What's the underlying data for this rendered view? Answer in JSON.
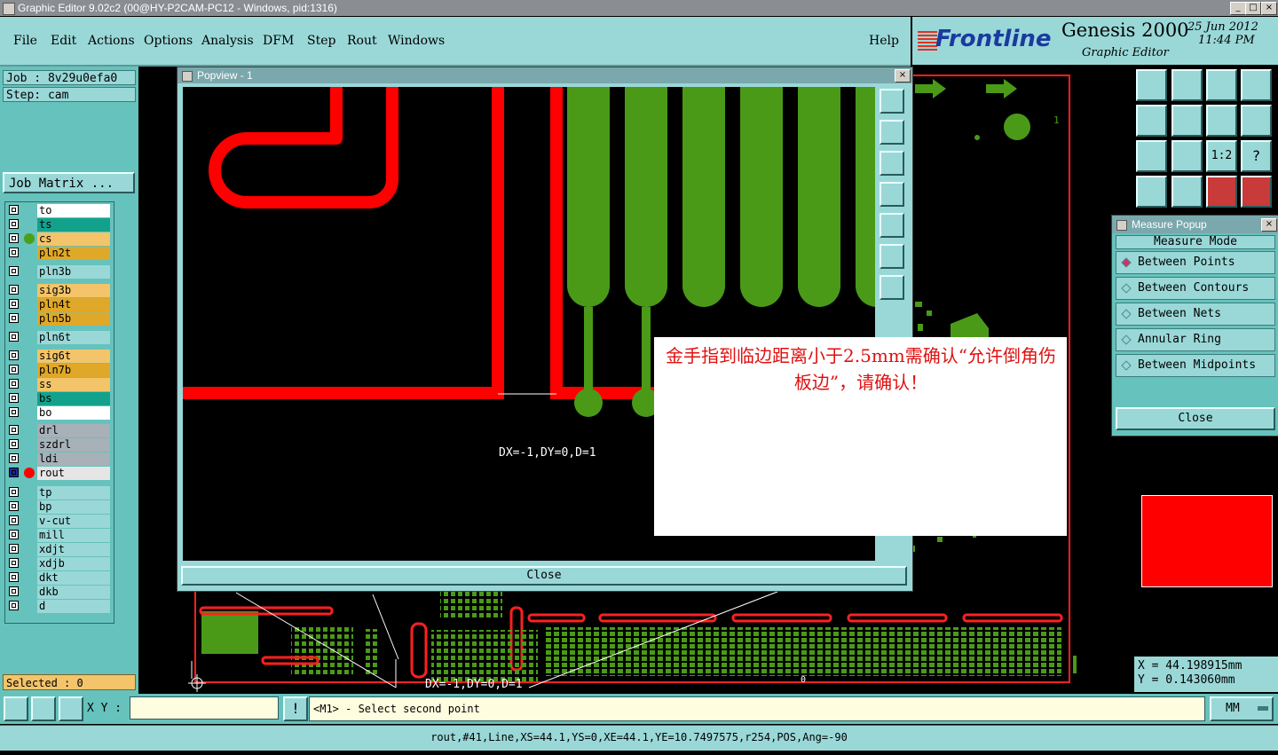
{
  "window": {
    "title": "Graphic Editor 9.02c2 (00@HY-P2CAM-PC12 - Windows, pid:1316)"
  },
  "menu": [
    {
      "id": "file",
      "label": "File"
    },
    {
      "id": "edit",
      "label": "Edit"
    },
    {
      "id": "actions",
      "label": "Actions"
    },
    {
      "id": "options",
      "label": "Options"
    },
    {
      "id": "analysis",
      "label": "Analysis"
    },
    {
      "id": "dfm",
      "label": "DFM"
    },
    {
      "id": "step",
      "label": "Step"
    },
    {
      "id": "rout",
      "label": "Rout"
    },
    {
      "id": "windows",
      "label": "Windows"
    }
  ],
  "help_label": "Help",
  "brand": {
    "logo": "Frontline",
    "product": "Genesis 2000",
    "subtitle": "Graphic Editor",
    "date": "25 Jun 2012",
    "time": "11:44 PM"
  },
  "job": {
    "job_label": "Job : 8v29u0efa0",
    "step_label": "Step: cam",
    "matrix_button": "Job Matrix ..."
  },
  "layers": [
    {
      "name": "to",
      "color": "#ffffff",
      "dot": ""
    },
    {
      "name": "ts",
      "color": "#12a28c",
      "dot": ""
    },
    {
      "name": "cs",
      "color": "#f3c46a",
      "dot": "#4aa018"
    },
    {
      "name": "pln2t",
      "color": "#e0a828",
      "dot": ""
    },
    {
      "name": "pln3b",
      "color": "#9ad8d8",
      "dot": ""
    },
    {
      "name": "sig3b",
      "color": "#f3c46a",
      "dot": ""
    },
    {
      "name": "pln4t",
      "color": "#e0a828",
      "dot": ""
    },
    {
      "name": "pln5b",
      "color": "#e0a828",
      "dot": ""
    },
    {
      "name": "pln6t",
      "color": "#9ad8d8",
      "dot": ""
    },
    {
      "name": "sig6t",
      "color": "#f3c46a",
      "dot": ""
    },
    {
      "name": "pln7b",
      "color": "#e0a828",
      "dot": ""
    },
    {
      "name": "ss",
      "color": "#f3c46a",
      "dot": ""
    },
    {
      "name": "bs",
      "color": "#12a28c",
      "dot": ""
    },
    {
      "name": "bo",
      "color": "#ffffff",
      "dot": ""
    },
    {
      "name": "drl",
      "color": "#a8b0b8",
      "dot": ""
    },
    {
      "name": "szdrl",
      "color": "#a8b0b8",
      "dot": ""
    },
    {
      "name": "ldi",
      "color": "#a8b0b8",
      "dot": ""
    },
    {
      "name": "rout",
      "color": "#e6e6e6",
      "dot": "#ff0000",
      "active": true
    },
    {
      "name": "tp",
      "color": "#9ad8d8",
      "dot": ""
    },
    {
      "name": "bp",
      "color": "#9ad8d8",
      "dot": ""
    },
    {
      "name": "v-cut",
      "color": "#9ad8d8",
      "dot": ""
    },
    {
      "name": "mill",
      "color": "#9ad8d8",
      "dot": ""
    },
    {
      "name": "xdjt",
      "color": "#9ad8d8",
      "dot": ""
    },
    {
      "name": "xdjb",
      "color": "#9ad8d8",
      "dot": ""
    },
    {
      "name": "dkt",
      "color": "#9ad8d8",
      "dot": ""
    },
    {
      "name": "dkb",
      "color": "#9ad8d8",
      "dot": ""
    },
    {
      "name": "d",
      "color": "#9ad8d8",
      "dot": ""
    }
  ],
  "selected_label": "Selected : 0",
  "popview": {
    "title": "Popview - 1",
    "measure_text": "DX=-1,DY=0,D=1",
    "close_label": "Close"
  },
  "dialog": {
    "message": "金手指到临边距离小于2.5mm需确认“允许倒角伤板边”，请确认！"
  },
  "measure_popup": {
    "title": "Measure Popup",
    "mode_label": "Measure Mode",
    "options": [
      {
        "label": "Between Points",
        "selected": true
      },
      {
        "label": "Between Contours",
        "selected": false
      },
      {
        "label": "Between Nets",
        "selected": false
      },
      {
        "label": "Annular Ring",
        "selected": false
      },
      {
        "label": "Between Midpoints",
        "selected": false
      }
    ],
    "close_label": "Close"
  },
  "coords": {
    "x": "X  =  44.198915mm",
    "y": "Y  =  0.143060mm"
  },
  "background_measure_text": "DX=-1,DY=0,D=1",
  "corner_number": "1",
  "zero_label": "0",
  "ratio_label": "1:2",
  "question_label": "?",
  "command": {
    "xy_label": "X Y :",
    "input_value": "",
    "bang": "!",
    "prompt": "<M1> - Select second point",
    "units": "MM"
  },
  "status": "rout,#41,Line,XS=44.1,YS=0,XE=44.1,YE=10.7497575,r254,POS,Ang=-90",
  "colors": {
    "trace_red": "#ff0000",
    "copper_green": "#4a9a18",
    "panel_cyan": "#9ad8d8",
    "panel_teal": "#66c2bc",
    "dialog_text": "#e01010"
  }
}
